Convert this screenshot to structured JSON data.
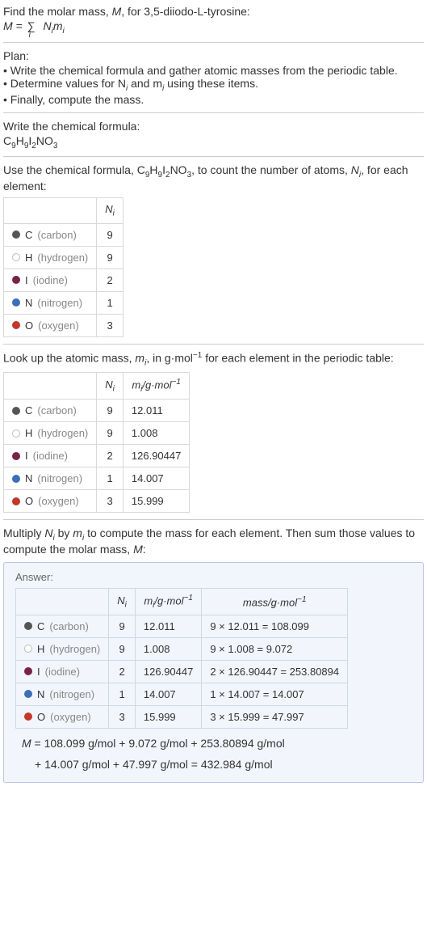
{
  "intro": {
    "line1_a": "Find the molar mass, ",
    "line1_m": "M",
    "line1_b": ", for 3,5-diiodo-L-tyrosine:",
    "formula_lhs": "M = ",
    "formula_sigma": "∑",
    "formula_sub": "i",
    "formula_rhs": " N",
    "formula_rhs_sub1": "i",
    "formula_rhs2": "m",
    "formula_rhs_sub2": "i"
  },
  "plan": {
    "title": "Plan:",
    "items": [
      "• Write the chemical formula and gather atomic masses from the periodic table.",
      "• Determine values for N",
      " and m",
      " using these items.",
      "• Finally, compute the mass."
    ],
    "sub_i": "i"
  },
  "step1": {
    "title": "Write the chemical formula:",
    "formula_parts": [
      "C",
      "9",
      "H",
      "9",
      "I",
      "2",
      "NO",
      "3"
    ]
  },
  "step2": {
    "pre": "Use the chemical formula, ",
    "post": ", to count the number of atoms, ",
    "post2": ", for each element:",
    "Ni": "N",
    "Ni_sub": "i"
  },
  "elements": [
    {
      "dot": "dot-c",
      "sym": "C",
      "name": "(carbon)",
      "n": "9",
      "m": "12.011",
      "mass": "9 × 12.011 = 108.099"
    },
    {
      "dot": "dot-h",
      "sym": "H",
      "name": "(hydrogen)",
      "n": "9",
      "m": "1.008",
      "mass": "9 × 1.008 = 9.072"
    },
    {
      "dot": "dot-i",
      "sym": "I",
      "name": "(iodine)",
      "n": "2",
      "m": "126.90447",
      "mass": "2 × 126.90447 = 253.80894"
    },
    {
      "dot": "dot-n",
      "sym": "N",
      "name": "(nitrogen)",
      "n": "1",
      "m": "14.007",
      "mass": "1 × 14.007 = 14.007"
    },
    {
      "dot": "dot-o",
      "sym": "O",
      "name": "(oxygen)",
      "n": "3",
      "m": "15.999",
      "mass": "3 × 15.999 = 47.997"
    }
  ],
  "step3": {
    "pre": "Look up the atomic mass, ",
    "mi": "m",
    "mi_sub": "i",
    "mid": ", in g·mol",
    "sup": "−1",
    "post": " for each element in the periodic table:"
  },
  "headers": {
    "Ni": "N",
    "Ni_sub": "i",
    "mi": "m",
    "mi_sub": "i",
    "mi_unit": "/g·mol",
    "mi_sup": "−1",
    "mass": "mass/g·mol",
    "mass_sup": "−1"
  },
  "step4": {
    "pre": "Multiply ",
    "n": "N",
    "n_sub": "i",
    "mid": " by ",
    "m": "m",
    "m_sub": "i",
    "post": " to compute the mass for each element. Then sum those values to compute the molar mass, ",
    "M": "M",
    "end": ":"
  },
  "answer": {
    "label": "Answer:",
    "line1_a": "M",
    "line1_b": " = 108.099 g/mol + 9.072 g/mol + 253.80894 g/mol",
    "line2": "+ 14.007 g/mol + 47.997 g/mol = 432.984 g/mol"
  }
}
